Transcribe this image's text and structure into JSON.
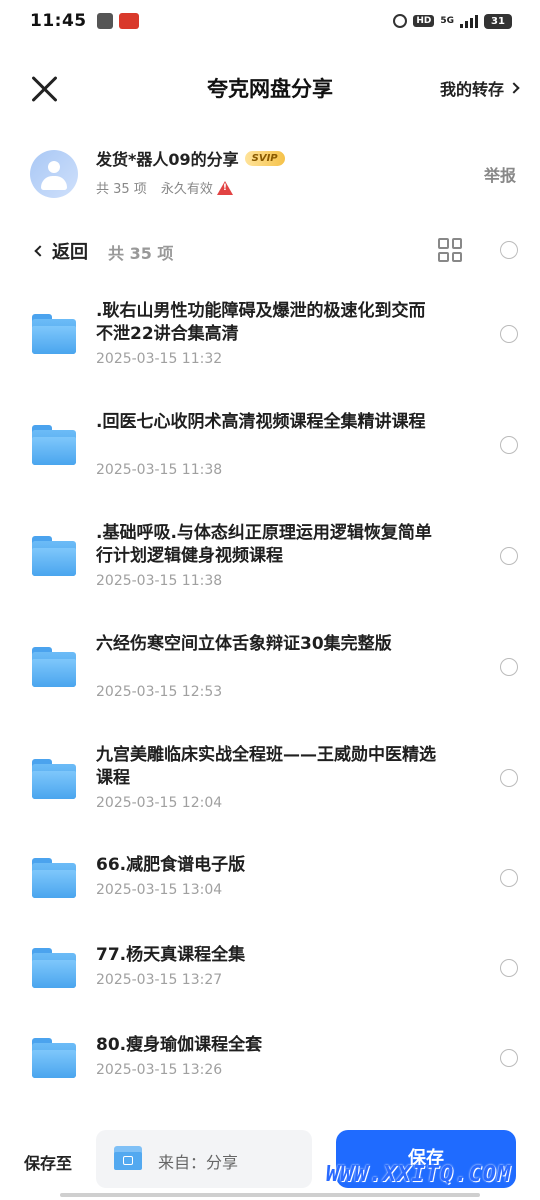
{
  "status_bar": {
    "time": "11:45",
    "hd": "HD",
    "network": "5G",
    "battery": "31"
  },
  "header": {
    "title": "夸克网盘分享",
    "my_transfer": "我的转存"
  },
  "sharer": {
    "name": "发货*器人09的分享",
    "badge": "SVIP",
    "count": "共 35 项",
    "validity": "永久有效",
    "report": "举报"
  },
  "toolbar": {
    "back": "返回",
    "count": "共 35 项"
  },
  "files": [
    {
      "name": ".耿右山男性功能障碍及爆泄的极速化到交而不泄22讲合集高清",
      "date": "2025-03-15 11:32"
    },
    {
      "name": ".回医七心收阴术高清视频课程全集精讲课程",
      "date": "2025-03-15 11:38"
    },
    {
      "name": ".基础呼吸.与体态纠正原理运用逻辑恢复简单行计划逻辑健身视频课程",
      "date": "2025-03-15 11:38"
    },
    {
      "name": "六经伤寒空间立体舌象辩证30集完整版",
      "date": "2025-03-15 12:53"
    },
    {
      "name": "九宫美雕临床实战全程班——王威勋中医精选课程",
      "date": "2025-03-15 12:04"
    },
    {
      "name": "66.减肥食谱电子版",
      "date": "2025-03-15 13:04"
    },
    {
      "name": "77.杨天真课程全集",
      "date": "2025-03-15 13:27"
    },
    {
      "name": "80.瘦身瑜伽课程全套",
      "date": "2025-03-15 13:26"
    }
  ],
  "bottom_bar": {
    "save_to": "保存至",
    "destination": "来自：分享",
    "save": "保存"
  },
  "watermark": "WWW.XXITQ.COM",
  "colors": {
    "accent": "#1f6bff",
    "folder": "#4aa5ee",
    "warning": "#e24343"
  }
}
